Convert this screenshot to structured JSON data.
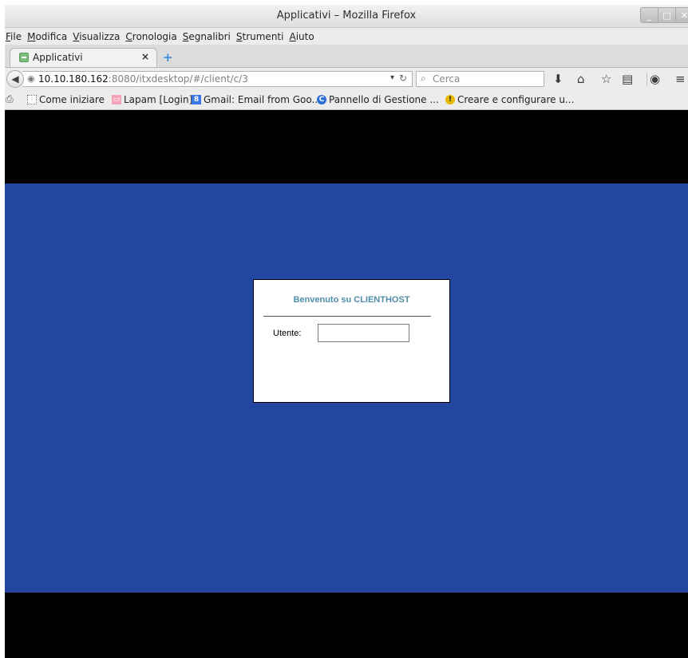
{
  "window": {
    "title": "Applicativi – Mozilla Firefox"
  },
  "wm_buttons": [
    "_",
    "□",
    "✕"
  ],
  "menu": [
    "File",
    "Modifica",
    "Visualizza",
    "Cronologia",
    "Segnalibri",
    "Strumenti",
    "Aiuto"
  ],
  "tab": {
    "label": "Applicativi",
    "close": "×",
    "new_tab": "+"
  },
  "navbar": {
    "url_host": "10.10.180.162",
    "url_path": ":8080/itxdesktop/#/client/c/3",
    "search_placeholder": "Cerca"
  },
  "icons": {
    "back": "back-arrow-icon",
    "globe": "globe-icon",
    "dropdown": "chevron-down-icon",
    "reload": "reload-icon",
    "search": "search-icon",
    "download": "download-icon",
    "home": "home-icon",
    "bookmark": "star-icon",
    "reading_list": "reading-list-icon",
    "pocket": "pocket-icon",
    "menu": "hamburger-menu-icon",
    "printer": "printer-icon"
  },
  "bookmarks": [
    {
      "label": "Come iniziare",
      "icon": "page-icon",
      "color": "#ffffff"
    },
    {
      "label": "Lapam [Login]",
      "icon": "lapam-icon",
      "color": "#f4a4b8"
    },
    {
      "label": "Gmail: Email from Goo...",
      "icon": "google-icon",
      "color": "#3b78e7"
    },
    {
      "label": "Pannello di Gestione ...",
      "icon": "panel-icon",
      "color": "#2a6fd6"
    },
    {
      "label": "Creare e configurare u...",
      "icon": "info-icon",
      "color": "#e6b800"
    }
  ],
  "login": {
    "welcome": "Benvenuto su CLIENTHOST",
    "user_label": "Utente:",
    "user_value": ""
  },
  "colors": {
    "panel_bg": "#2347a0",
    "letterbox": "#000000",
    "welcome_text": "#4f8fa9"
  }
}
